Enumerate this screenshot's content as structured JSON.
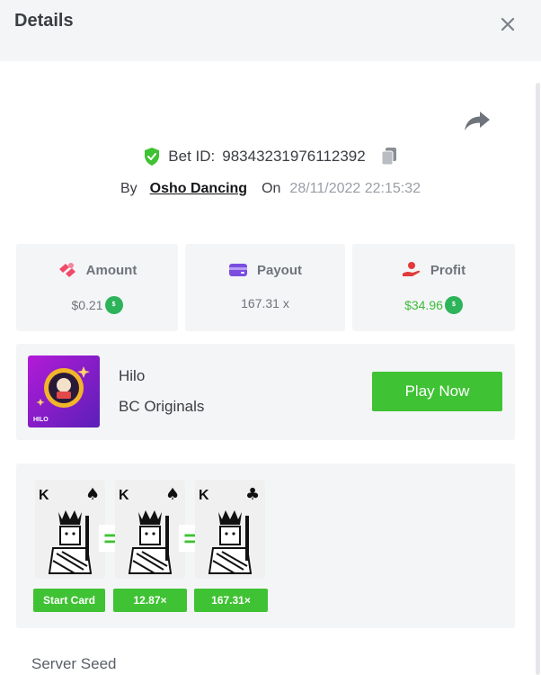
{
  "header": {
    "title": "Details",
    "close_icon": "close-icon"
  },
  "bet": {
    "id_label": "Bet ID:",
    "id_value": "98343231976112392",
    "by_label": "By",
    "user": "Osho Dancing",
    "on_label": "On",
    "datetime": "28/11/2022 22:15:32"
  },
  "stats": {
    "amount_label": "Amount",
    "amount_value": "$0.21",
    "payout_label": "Payout",
    "payout_value": "167.31 x",
    "profit_label": "Profit",
    "profit_value": "$34.96"
  },
  "game": {
    "name": "Hilo",
    "provider": "BC Originals",
    "thumb_label": "HILO",
    "play_label": "Play Now"
  },
  "cards": [
    {
      "rank": "K",
      "suit": "♠",
      "tag": "Start Card"
    },
    {
      "rank": "K",
      "suit": "♠",
      "tag": "12.87×"
    },
    {
      "rank": "K",
      "suit": "♣",
      "tag": "167.31×"
    }
  ],
  "equals": [
    "=",
    "="
  ],
  "server_seed_label": "Server Seed",
  "colors": {
    "accent_green": "#3fc233",
    "panel_bg": "#f4f5f7",
    "profit_green": "#3dbb3a"
  }
}
